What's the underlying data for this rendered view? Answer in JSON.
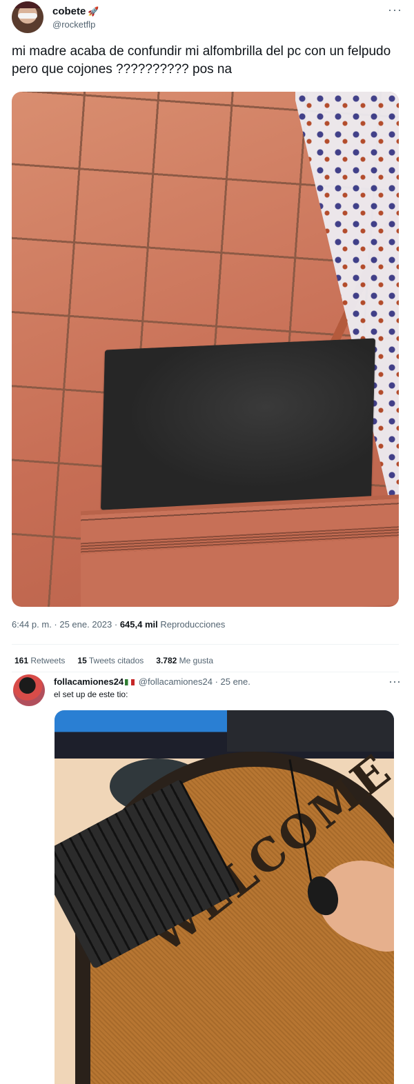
{
  "tweet": {
    "display_name": "cobete",
    "name_emoji": "🚀",
    "handle": "@rocketflp",
    "more": "···",
    "text": "mi madre acaba de confundir mi alfombrilla del pc con un felpudo pero que cojones ?????????? pos na",
    "time": "6:44 p. m. · 25 ene. 2023 · ",
    "views_count": "645,4 mil",
    "views_label": " Reproducciones"
  },
  "stats": {
    "retweets_count": "161",
    "retweets_label": "Retweets",
    "quotes_count": "15",
    "quotes_label": "Tweets citados",
    "likes_count": "3.782",
    "likes_label": "Me gusta"
  },
  "reply": {
    "display_name": "follacamiones24",
    "handle": "@follacamiones24",
    "date": "· 25 ene.",
    "text": "el set up de este tio:",
    "more": "···"
  },
  "photo2": {
    "mat_text": "WELCOME"
  }
}
